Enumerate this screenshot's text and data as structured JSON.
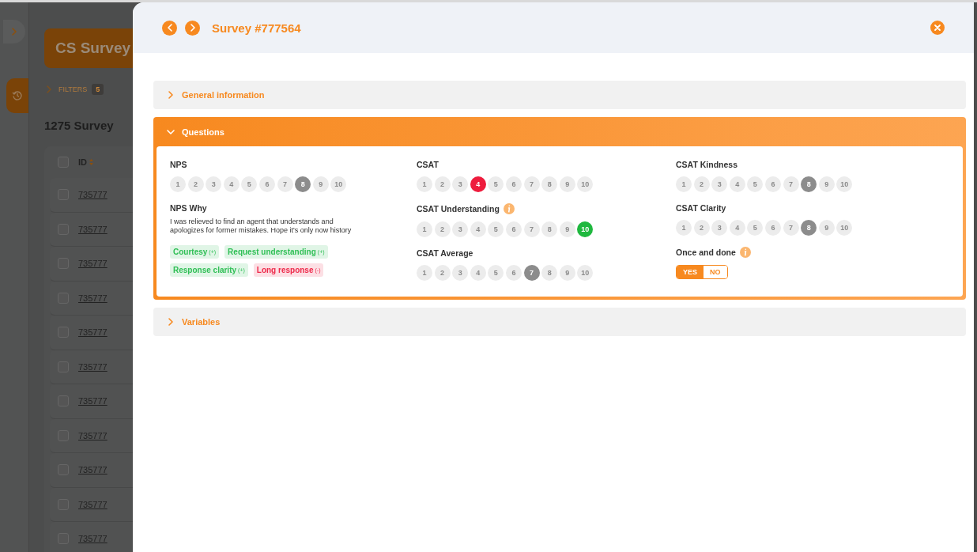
{
  "background": {
    "title": "CS Survey",
    "filters": {
      "label": "FILTERS",
      "count": "5"
    },
    "count_title": "1275 Survey",
    "table": {
      "columns": [
        "ID"
      ],
      "all_checked": false,
      "rows": [
        {
          "id": "735777",
          "checked": false
        },
        {
          "id": "735777",
          "checked": false
        },
        {
          "id": "735777",
          "checked": false
        },
        {
          "id": "735777",
          "checked": false
        },
        {
          "id": "735777",
          "checked": false
        },
        {
          "id": "735777",
          "checked": false
        },
        {
          "id": "735777",
          "checked": false
        },
        {
          "id": "735777",
          "checked": false
        },
        {
          "id": "735777",
          "checked": false
        },
        {
          "id": "735777",
          "checked": false
        },
        {
          "id": "735777",
          "checked": false
        }
      ]
    }
  },
  "panel": {
    "title": "Survey #777564",
    "sections": [
      {
        "title": "General information",
        "expanded": false
      },
      {
        "title": "Questions",
        "expanded": true,
        "columns": [
          [
            {
              "kind": "scale",
              "label": "NPS",
              "info": false,
              "color": "#8c8c8c",
              "options": [
                {
                  "label": "1",
                  "selected": false
                },
                {
                  "label": "2",
                  "selected": false
                },
                {
                  "label": "3",
                  "selected": false
                },
                {
                  "label": "4",
                  "selected": false
                },
                {
                  "label": "5",
                  "selected": false
                },
                {
                  "label": "6",
                  "selected": false
                },
                {
                  "label": "7",
                  "selected": false
                },
                {
                  "label": "8",
                  "selected": true
                },
                {
                  "label": "9",
                  "selected": false
                },
                {
                  "label": "10",
                  "selected": false
                }
              ]
            },
            {
              "kind": "text",
              "label": "NPS Why",
              "info": false,
              "text": "I was relieved to find an agent that understands and apologizes for former mistakes. Hope it's only now history",
              "tags": [
                {
                  "label": "Courtesy",
                  "sign": "(+)",
                  "color": "#2fbf55"
                },
                {
                  "label": "Request understanding",
                  "sign": "(+)",
                  "color": "#2fbf55"
                },
                {
                  "label": "Response clarity",
                  "sign": "(+)",
                  "color": "#2fbf55"
                },
                {
                  "label": "Long response",
                  "sign": "(-)",
                  "color": "#ee2a4b"
                }
              ]
            }
          ],
          [
            {
              "kind": "scale",
              "label": "CSAT",
              "info": false,
              "color": "#ee1c3d",
              "options": [
                {
                  "label": "1",
                  "selected": false
                },
                {
                  "label": "2",
                  "selected": false
                },
                {
                  "label": "3",
                  "selected": false
                },
                {
                  "label": "4",
                  "selected": true
                },
                {
                  "label": "5",
                  "selected": false
                },
                {
                  "label": "6",
                  "selected": false
                },
                {
                  "label": "7",
                  "selected": false
                },
                {
                  "label": "8",
                  "selected": false
                },
                {
                  "label": "9",
                  "selected": false
                },
                {
                  "label": "10",
                  "selected": false
                }
              ]
            },
            {
              "kind": "scale",
              "label": "CSAT Understanding",
              "info": true,
              "color": "#1fb83f",
              "options": [
                {
                  "label": "1",
                  "selected": false
                },
                {
                  "label": "2",
                  "selected": false
                },
                {
                  "label": "3",
                  "selected": false
                },
                {
                  "label": "4",
                  "selected": false
                },
                {
                  "label": "5",
                  "selected": false
                },
                {
                  "label": "6",
                  "selected": false
                },
                {
                  "label": "7",
                  "selected": false
                },
                {
                  "label": "8",
                  "selected": false
                },
                {
                  "label": "9",
                  "selected": false
                },
                {
                  "label": "10",
                  "selected": true
                }
              ]
            },
            {
              "kind": "scale",
              "label": "CSAT Average",
              "info": false,
              "color": "#8c8c8c",
              "options": [
                {
                  "label": "1",
                  "selected": false
                },
                {
                  "label": "2",
                  "selected": false
                },
                {
                  "label": "3",
                  "selected": false
                },
                {
                  "label": "4",
                  "selected": false
                },
                {
                  "label": "5",
                  "selected": false
                },
                {
                  "label": "6",
                  "selected": false
                },
                {
                  "label": "7",
                  "selected": true
                },
                {
                  "label": "8",
                  "selected": false
                },
                {
                  "label": "9",
                  "selected": false
                },
                {
                  "label": "10",
                  "selected": false
                }
              ]
            }
          ],
          [
            {
              "kind": "scale",
              "label": "CSAT Kindness",
              "info": false,
              "color": "#8c8c8c",
              "options": [
                {
                  "label": "1",
                  "selected": false
                },
                {
                  "label": "2",
                  "selected": false
                },
                {
                  "label": "3",
                  "selected": false
                },
                {
                  "label": "4",
                  "selected": false
                },
                {
                  "label": "5",
                  "selected": false
                },
                {
                  "label": "6",
                  "selected": false
                },
                {
                  "label": "7",
                  "selected": false
                },
                {
                  "label": "8",
                  "selected": true
                },
                {
                  "label": "9",
                  "selected": false
                },
                {
                  "label": "10",
                  "selected": false
                }
              ]
            },
            {
              "kind": "scale",
              "label": "CSAT Clarity",
              "info": false,
              "color": "#8c8c8c",
              "options": [
                {
                  "label": "1",
                  "selected": false
                },
                {
                  "label": "2",
                  "selected": false
                },
                {
                  "label": "3",
                  "selected": false
                },
                {
                  "label": "4",
                  "selected": false
                },
                {
                  "label": "5",
                  "selected": false
                },
                {
                  "label": "6",
                  "selected": false
                },
                {
                  "label": "7",
                  "selected": false
                },
                {
                  "label": "8",
                  "selected": true
                },
                {
                  "label": "9",
                  "selected": false
                },
                {
                  "label": "10",
                  "selected": false
                }
              ]
            },
            {
              "kind": "toggle",
              "label": "Once and done",
              "info": true,
              "options": [
                {
                  "label": "YES",
                  "selected": true
                },
                {
                  "label": "NO",
                  "selected": false
                }
              ]
            }
          ]
        ]
      },
      {
        "title": "Variables",
        "expanded": false
      }
    ]
  }
}
